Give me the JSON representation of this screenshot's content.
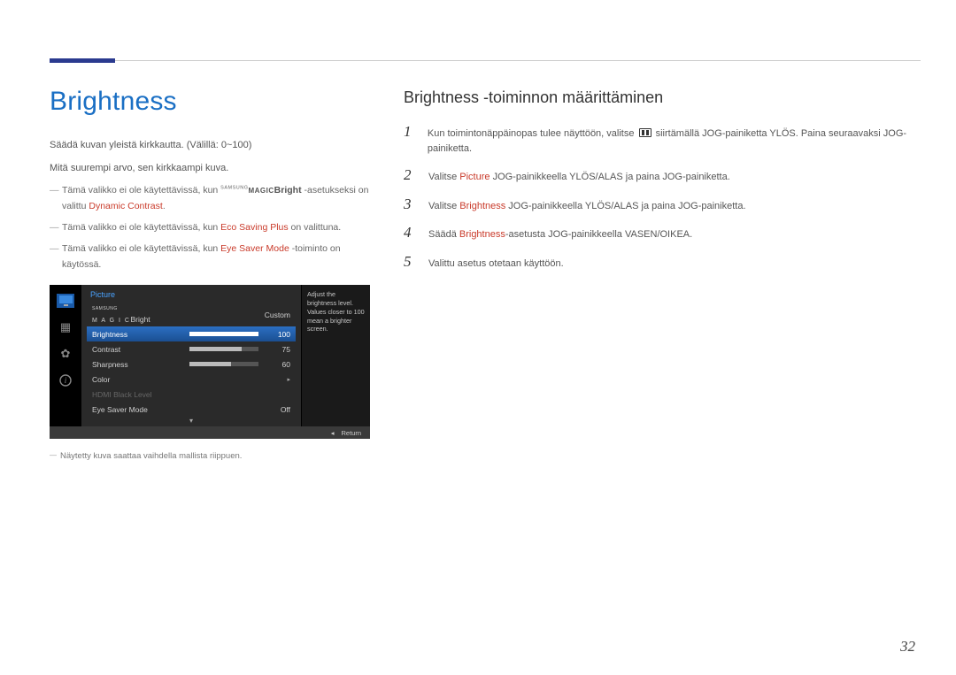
{
  "page_number": "32",
  "left": {
    "heading": "Brightness",
    "p1": "Säädä kuvan yleistä kirkkautta. (Välillä: 0~100)",
    "p2": "Mitä suurempi arvo, sen kirkkaampi kuva.",
    "note1_prefix": "Tämä valikko ei ole käytettävissä, kun ",
    "note1_brand_tiny": "SAMSUNG",
    "note1_brand_magic": "MAGIC",
    "note1_bright": "Bright",
    "note1_mid": " -asetukseksi on valittu ",
    "note1_red": "Dynamic Contrast",
    "note1_suffix": ".",
    "note2_prefix": "Tämä valikko ei ole käytettävissä, kun ",
    "note2_red": "Eco Saving Plus",
    "note2_suffix": " on valittuna.",
    "note3_prefix": "Tämä valikko ei ole käytettävissä, kun ",
    "note3_red": "Eye Saver Mode",
    "note3_suffix": " -toiminto on käytössä.",
    "footnote": "Näytetty kuva saattaa vaihdella mallista riippuen."
  },
  "osd": {
    "title": "Picture",
    "help": "Adjust the brightness level. Values closer to 100 mean a brighter screen.",
    "rows": {
      "magic_tiny": "SAMSUNG",
      "magic_letters": "M A G I C",
      "magic_bright": "Bright",
      "magic_value": "Custom",
      "brightness_label": "Brightness",
      "brightness_value": "100",
      "contrast_label": "Contrast",
      "contrast_value": "75",
      "sharpness_label": "Sharpness",
      "sharpness_value": "60",
      "color_label": "Color",
      "hdmi_label": "HDMI Black Level",
      "eyesaver_label": "Eye Saver Mode",
      "eyesaver_value": "Off"
    },
    "footer_return": "Return"
  },
  "right": {
    "heading": "Brightness -toiminnon määrittäminen",
    "steps": {
      "s1_a": "Kun toimintonäppäinopas tulee näyttöön, valitse ",
      "s1_b": " siirtämällä JOG-painiketta YLÖS. Paina seuraavaksi JOG-painiketta.",
      "s2_a": "Valitse ",
      "s2_red": "Picture",
      "s2_b": " JOG-painikkeella YLÖS/ALAS ja paina JOG-painiketta.",
      "s3_a": "Valitse ",
      "s3_red": "Brightness",
      "s3_b": " JOG-painikkeella YLÖS/ALAS ja paina JOG-painiketta.",
      "s4_a": "Säädä ",
      "s4_red": "Brightness",
      "s4_b": "-asetusta JOG-painikkeella VASEN/OIKEA.",
      "s5": "Valittu asetus otetaan käyttöön."
    }
  }
}
